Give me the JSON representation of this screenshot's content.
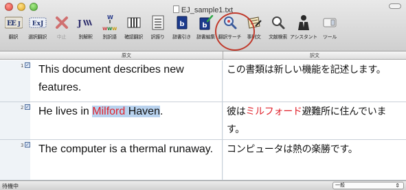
{
  "window": {
    "title": "EJ_sample1.txt"
  },
  "toolbar": {
    "items": [
      {
        "label": "翻訳",
        "icon": "ej-translate-icon"
      },
      {
        "label": "選択翻訳",
        "icon": "ej-selection-translate-icon"
      },
      {
        "label": "中止",
        "icon": "stop-icon",
        "disabled": true
      },
      {
        "label": "別解釈",
        "icon": "alternate-interpretation-icon"
      },
      {
        "label": "別訳語",
        "icon": "alternate-word-icon"
      },
      {
        "label": "確認翻訳",
        "icon": "confirm-translation-icon"
      },
      {
        "label": "訳振り",
        "icon": "interlinear-icon"
      },
      {
        "label": "辞書引き",
        "icon": "dictionary-lookup-icon"
      },
      {
        "label": "辞書編集",
        "icon": "dictionary-edit-icon"
      },
      {
        "label": "翻訳サーチ",
        "icon": "translation-search-icon"
      },
      {
        "label": "事例文",
        "icon": "example-sentence-icon"
      },
      {
        "label": "文献検索",
        "icon": "literature-search-icon"
      },
      {
        "label": "アシスタント",
        "icon": "assistant-icon"
      },
      {
        "label": "ツール",
        "icon": "tools-icon"
      }
    ]
  },
  "columns": {
    "source": "原文",
    "target": "訳文"
  },
  "rows": [
    {
      "num": "1",
      "source": "This document describes new features.",
      "target": "この書類は新しい機能を記述します。"
    },
    {
      "num": "2",
      "source_before": "He lives in ",
      "source_highlight": "Milford",
      "source_highlight_rest": " Haven",
      "source_after": ".",
      "target_before": "彼は",
      "target_highlight": "ミルフォード",
      "target_after": "避難所に住んでいます。"
    },
    {
      "num": "3",
      "source": "The computer is a thermal runaway.",
      "target": "コンピュータは熱の楽勝です。"
    }
  ],
  "status": {
    "text": "待機中",
    "mode": "一般"
  },
  "colors": {
    "highlight": "#b8d2ee",
    "proper_noun": "#e0202a",
    "annotation_circle": "#c0392b"
  }
}
